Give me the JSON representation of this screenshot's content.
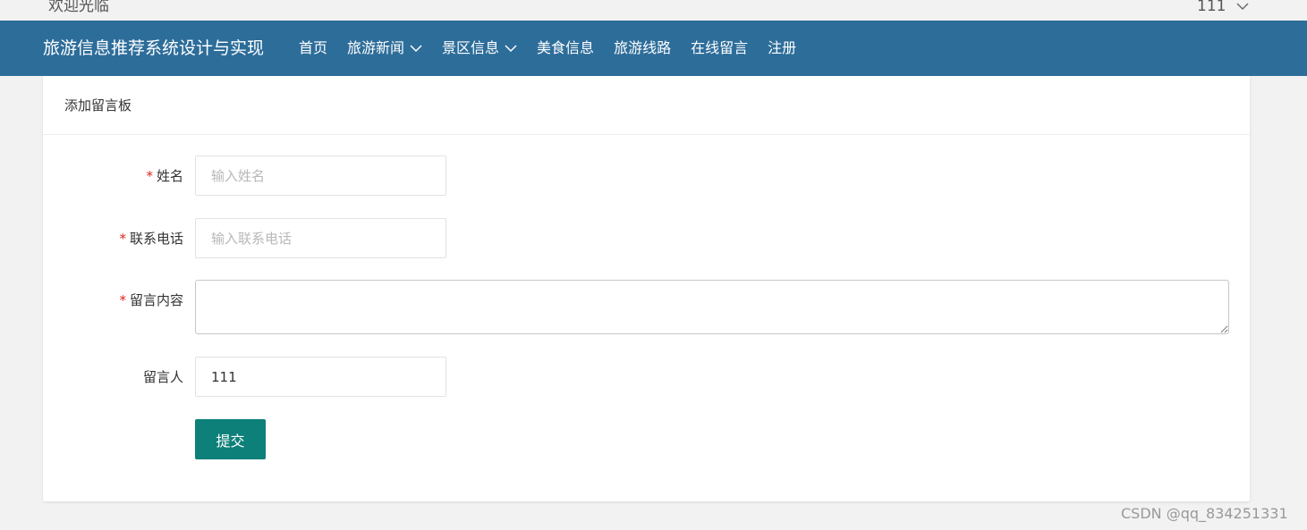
{
  "topbar": {
    "welcome": "欢迎光临",
    "username": "111"
  },
  "navbar": {
    "brand": "旅游信息推荐系统设计与实现",
    "items": [
      {
        "label": "首页",
        "dropdown": false
      },
      {
        "label": "旅游新闻",
        "dropdown": true
      },
      {
        "label": "景区信息",
        "dropdown": true
      },
      {
        "label": "美食信息",
        "dropdown": false
      },
      {
        "label": "旅游线路",
        "dropdown": false
      },
      {
        "label": "在线留言",
        "dropdown": false
      },
      {
        "label": "注册",
        "dropdown": false
      }
    ]
  },
  "form": {
    "title": "添加留言板",
    "required_mark": "*",
    "name": {
      "label": "姓名",
      "placeholder": "输入姓名",
      "value": ""
    },
    "phone": {
      "label": "联系电话",
      "placeholder": "输入联系电话",
      "value": ""
    },
    "content": {
      "label": "留言内容",
      "value": ""
    },
    "author": {
      "label": "留言人",
      "value": "111"
    },
    "submit_label": "提交"
  },
  "watermark": "CSDN @qq_834251331",
  "colors": {
    "navbar_bg": "#2d6d9a",
    "submit_bg": "#0d8079",
    "required": "#e1251b",
    "page_bg": "#f2f2f2"
  }
}
